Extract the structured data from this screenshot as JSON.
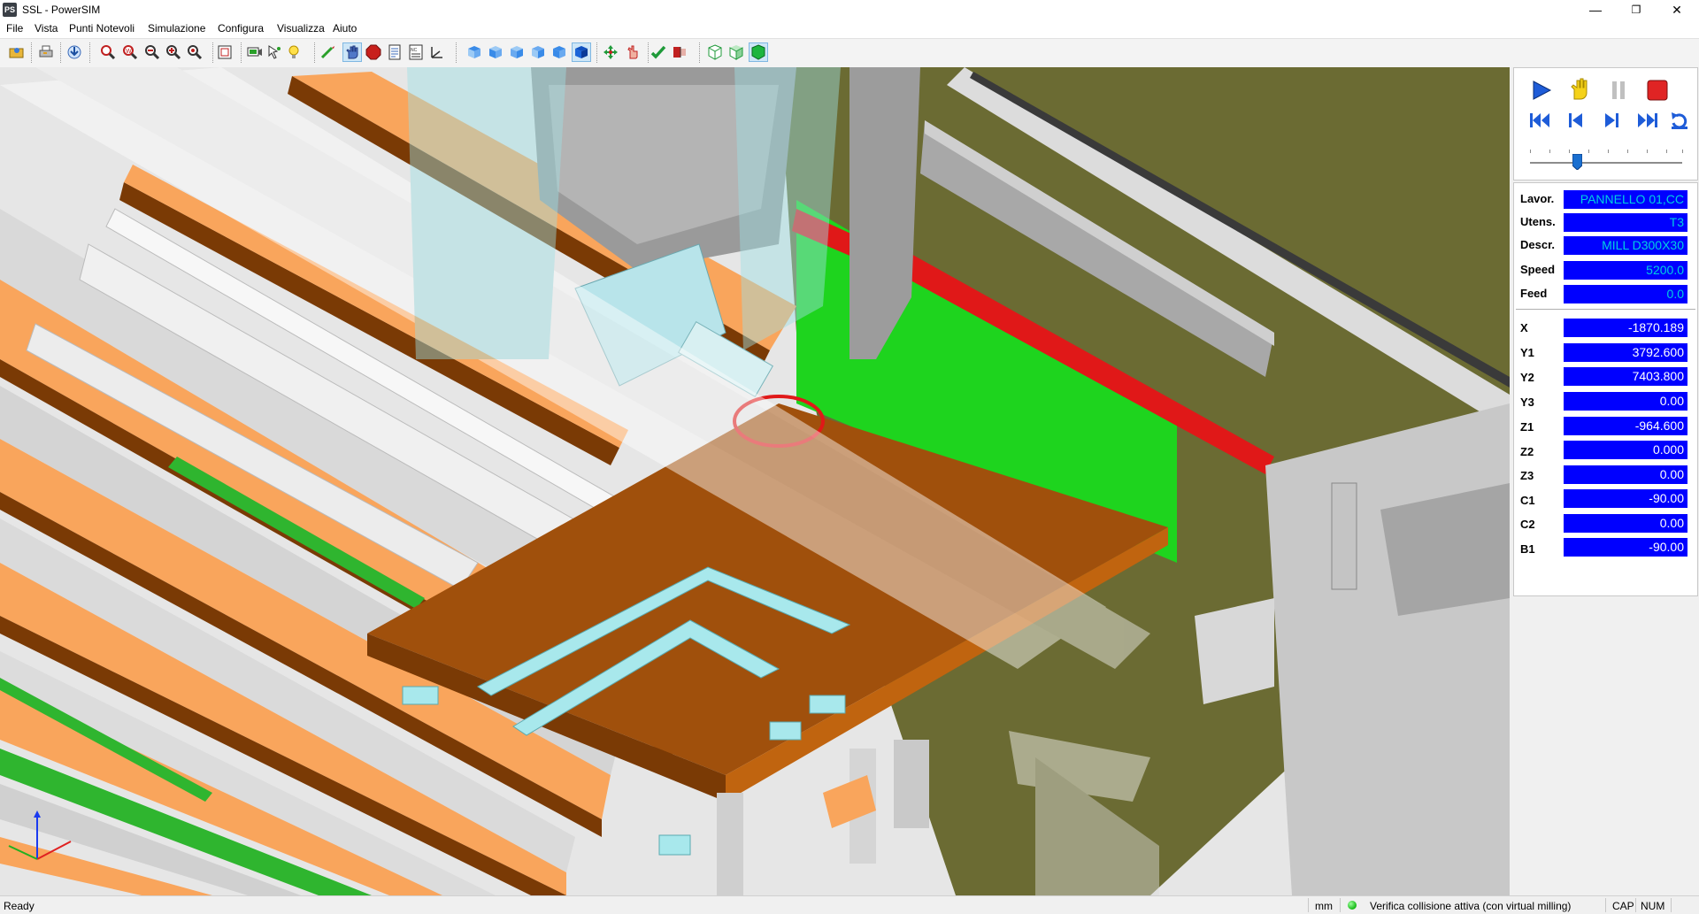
{
  "window": {
    "app_icon_label": "PS",
    "title": "SSL - PowerSIM",
    "min_glyph": "—",
    "max_glyph": "❐",
    "close_glyph": "✕"
  },
  "menu": [
    "File",
    "Vista",
    "Punti Notevoli",
    "Simulazione",
    "Configura",
    "Visualizza",
    "Aiuto"
  ],
  "toolbar_icons": [
    "open-icon",
    "print-icon",
    "import-icon",
    "zoom-window-icon",
    "zoom-all-icon",
    "zoom-out-icon",
    "zoom-in-icon",
    "zoom-previous-icon",
    "fit-view-icon",
    "display-icon",
    "select-icon",
    "light-icon",
    "tool-path-icon",
    "hand-icon",
    "stop-sign-icon",
    "report-icon",
    "program-icon",
    "axes-icon",
    "view-top-icon",
    "view-front-icon",
    "view-left-icon",
    "view-right-icon",
    "view-iso-icon",
    "view-solid-icon",
    "move-icon",
    "pointer-icon",
    "check-icon",
    "collision-icon",
    "box-wire-icon",
    "box-shaded-icon",
    "box-green-icon"
  ],
  "simulation_controls": [
    "play-icon",
    "hand-pause-icon",
    "pause-icon",
    "stop-icon",
    "skip-start-icon",
    "step-back-icon",
    "step-forward-icon",
    "skip-end-icon",
    "loop-icon"
  ],
  "speed_slider": {
    "position": 0.28
  },
  "readouts": {
    "job": [
      {
        "label": "Lavor.",
        "value": "PANNELLO 01,CC"
      },
      {
        "label": "Utens.",
        "value": "T3"
      },
      {
        "label": "Descr.",
        "value": "MILL D300X30"
      },
      {
        "label": "Speed",
        "value": "5200.0"
      },
      {
        "label": "Feed",
        "value": "0.0"
      }
    ],
    "axes": [
      {
        "label": "X",
        "value": "-1870.189"
      },
      {
        "label": "Y1",
        "value": "3792.600"
      },
      {
        "label": "Y2",
        "value": "7403.800"
      },
      {
        "label": "Y3",
        "value": "0.00"
      },
      {
        "label": "Z1",
        "value": "-964.600"
      },
      {
        "label": "Z2",
        "value": "0.000"
      },
      {
        "label": "Z3",
        "value": "0.00"
      },
      {
        "label": "C1",
        "value": "-90.00"
      },
      {
        "label": "C2",
        "value": "0.00"
      },
      {
        "label": "B1",
        "value": "-90.00"
      }
    ]
  },
  "status": {
    "ready": "Ready",
    "units": "mm",
    "collision": "Verifica collisione attiva  (con virtual milling)",
    "cap": "CAP",
    "num": "NUM"
  },
  "colors": {
    "accent_blue": "#0000ff",
    "readout_cyan": "#00d0e0",
    "panel_wood": "#a0500c",
    "rail_orange": "#f9a55c",
    "floor_olive": "#6b6b33",
    "safety_green": "#1ed41e",
    "safety_red": "#e01818",
    "milled_slot": "#a8e8ec"
  }
}
